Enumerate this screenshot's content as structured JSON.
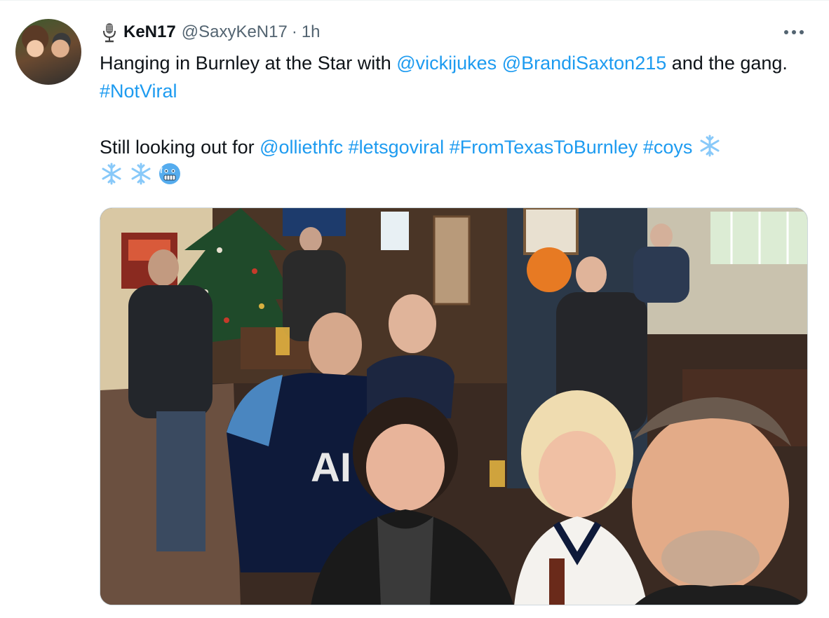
{
  "tweet": {
    "display_name": "KeN17",
    "handle": "@SaxyKeN17",
    "separator": "·",
    "time": "1h",
    "line1": {
      "text_a": "Hanging in Burnley at the Star with ",
      "mention_1": "@vickijukes",
      "mention_2": "@BrandiSaxton215",
      "text_b": " and the gang.  ",
      "hashtag": "#NotViral"
    },
    "line2": {
      "text_a": "Still looking out for ",
      "mention": "@olliethfc",
      "hashtag_1": "#letsgoviral",
      "hashtag_2": "#FromTexasToBurnley",
      "hashtag_3": "#coys"
    },
    "emojis": [
      "snowflake-emoji",
      "snowflake-emoji",
      "snowflake-emoji",
      "cold-face-emoji"
    ]
  },
  "photo": {
    "description": "",
    "shirt_text": "AI"
  },
  "colors": {
    "link": "#1d9bf0",
    "secondary_text": "#536471",
    "primary_text": "#0f1419"
  },
  "icons": {
    "verified_badge": "microphone-icon",
    "menu": "more-options-icon"
  }
}
